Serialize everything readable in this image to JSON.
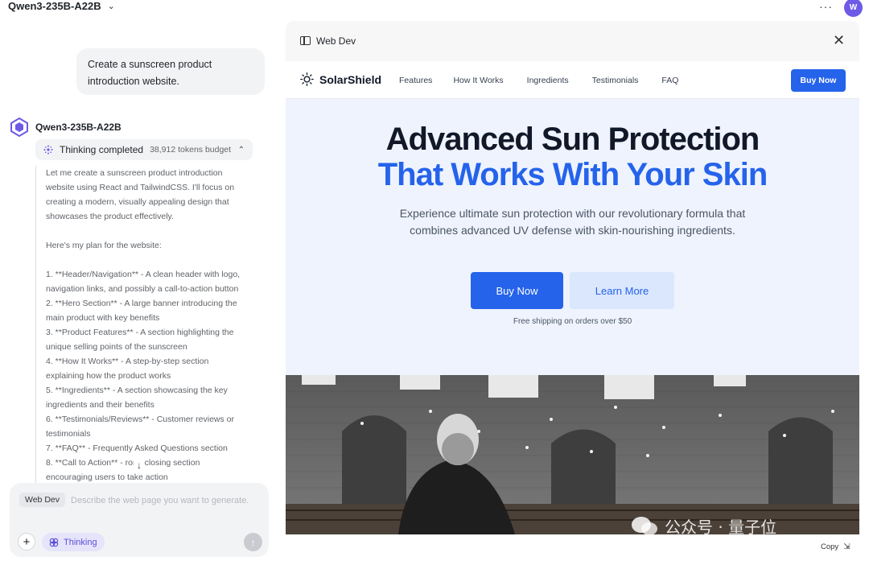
{
  "topbar": {
    "model_name": "Qwen3-235B-A22B",
    "more_label": "···",
    "avatar_initial": "W"
  },
  "chat": {
    "user_message": "Create a sunscreen product introduction website.",
    "assistant_name": "Qwen3-235B-A22B",
    "thinking": {
      "label": "Thinking completed",
      "budget": "38,912 tokens budget"
    },
    "thinking_lines": [
      "Let me create a sunscreen product introduction",
      "website using React and TailwindCSS. I'll focus on",
      "creating a modern, visually appealing design that",
      "showcases the product effectively.",
      "",
      "Here's my plan for the website:",
      "",
      "1. **Header/Navigation** - A clean header with logo,",
      "navigation links, and possibly a call-to-action button",
      "2. **Hero Section** - A large banner introducing the",
      "main product with key benefits",
      "3. **Product Features** - A section highlighting the",
      "unique selling points of the sunscreen",
      "4. **How It Works** - A step-by-step section",
      "explaining how the product works",
      "5. **Ingredients** - A section showcasing the key",
      "ingredients and their benefits",
      "6. **Testimonials/Reviews** - Customer reviews or",
      "testimonials",
      "7. **FAQ** - Frequently Asked Questions section",
      "8. **Call to Action** -     rong closing section",
      "encouraging users to take action"
    ]
  },
  "input": {
    "tag": "Web Dev",
    "placeholder": "Describe the web page you want to generate.",
    "thinking_toggle": "Thinking"
  },
  "panel": {
    "title": "Web Dev",
    "copy_label": "Copy"
  },
  "site": {
    "brand": "SolarShield",
    "nav": [
      "Features",
      "How It Works",
      "Ingredients",
      "Testimonials",
      "FAQ"
    ],
    "nav_buy": "Buy Now",
    "headline_1": "Advanced Sun Protection",
    "headline_2": "That Works With Your Skin",
    "subtext": "Experience ultimate sun protection with our revolutionary formula that combines advanced UV defense with skin-nourishing ingredients.",
    "cta_buy": "Buy Now",
    "cta_learn": "Learn More",
    "note": "Free shipping on orders over $50",
    "accent": "#2563eb"
  },
  "watermark": "公众号 · 量子位"
}
